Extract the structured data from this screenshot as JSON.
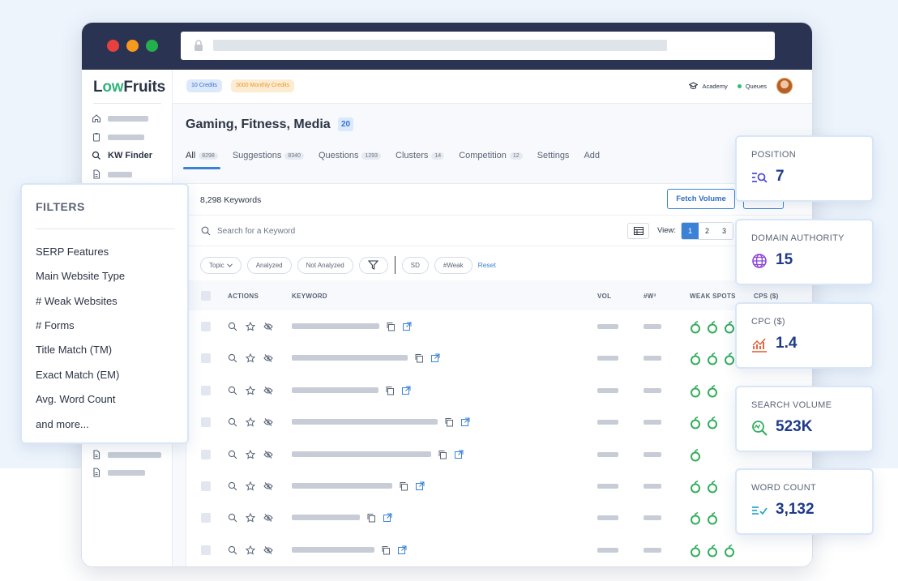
{
  "brand": {
    "logo_prefix": "L",
    "logo_accent": "ow",
    "logo_suffix": "Fruits"
  },
  "sidebar": {
    "active_item": "KW Finder"
  },
  "topbar": {
    "credits": "10 Credits",
    "monthly_credits": "3000 Monthly Credits",
    "academy": "Academy",
    "queues": "Queues"
  },
  "page": {
    "title": "Gaming, Fitness, Media",
    "count": "20"
  },
  "tabs": [
    {
      "label": "All",
      "count": "8298"
    },
    {
      "label": "Suggestions",
      "count": "8340"
    },
    {
      "label": "Questions",
      "count": "1293"
    },
    {
      "label": "Clusters",
      "count": "14"
    },
    {
      "label": "Competition",
      "count": "12"
    },
    {
      "label": "Settings",
      "count": ""
    },
    {
      "label": "Add",
      "count": ""
    }
  ],
  "toolbar": {
    "keyword_count": "8,298 Keywords",
    "fetch_volume": "Fetch Volume",
    "search_placeholder": "Search for a Keyword",
    "view_label": "View:",
    "pages": [
      "1",
      "2",
      "3"
    ],
    "current_page": "1"
  },
  "filter_chips": {
    "topic": "Topic",
    "analyzed": "Analyzed",
    "not_analyzed": "Not Analyzed",
    "sd": "SD",
    "weak": "#Weak",
    "reset": "Reset"
  },
  "table": {
    "headers": {
      "actions": "ACTIONS",
      "keyword": "KEYWORD",
      "vol": "VOL",
      "w": "#W³",
      "weak_spots": "WEAK SPOTS",
      "cps": "CPS ($)"
    },
    "weak_spots_per_row": [
      3,
      3,
      2,
      2,
      1,
      2,
      2,
      3
    ]
  },
  "filters": {
    "title": "FILTERS",
    "items": [
      "SERP Features",
      "Main Website Type",
      "# Weak Websites",
      "# Forms",
      "Title Match (TM)",
      "Exact Match (EM)",
      "Avg. Word Count",
      "and more..."
    ]
  },
  "metrics": [
    {
      "label": "POSITION",
      "value": "7",
      "icon": "position-search-icon",
      "color": "#4f4ed6"
    },
    {
      "label": "DOMAIN AUTHORITY",
      "value": "15",
      "icon": "globe-icon",
      "color": "#8b46d6"
    },
    {
      "label": "CPC ($)",
      "value": "1.4",
      "icon": "chart-trend-icon",
      "color": "#e0572e"
    },
    {
      "label": "SEARCH VOLUME",
      "value": "523K",
      "icon": "search-volume-icon",
      "color": "#2fae5b"
    },
    {
      "label": "WORD COUNT",
      "value": "3,132",
      "icon": "word-count-check-icon",
      "color": "#2aa9c9"
    }
  ]
}
